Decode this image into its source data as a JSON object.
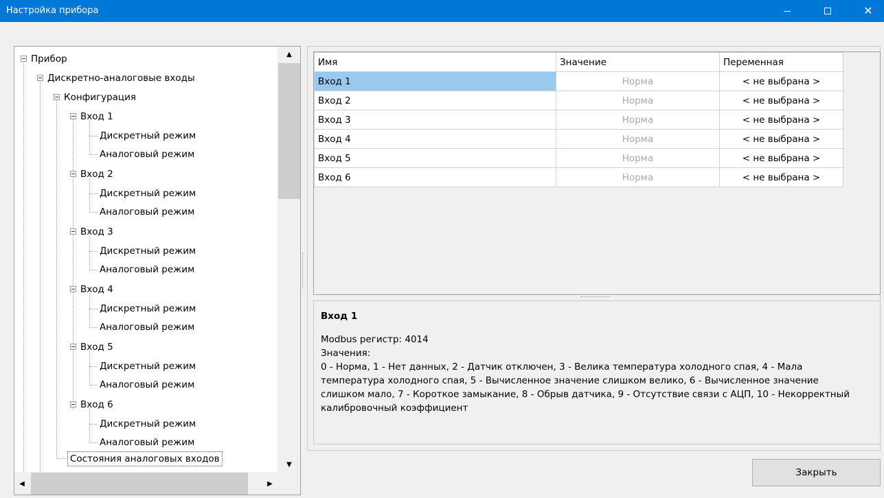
{
  "window": {
    "title": "Настройка прибора",
    "minimize_glyph": "—",
    "close_glyph": "✕"
  },
  "tree": {
    "root": "Прибор",
    "group": "Дискретно-аналоговые входы",
    "config": "Конфигурация",
    "inputs": [
      {
        "label": "Вход 1",
        "children": [
          "Дискретный режим",
          "Аналоговый режим"
        ]
      },
      {
        "label": "Вход 2",
        "children": [
          "Дискретный режим",
          "Аналоговый режим"
        ]
      },
      {
        "label": "Вход 3",
        "children": [
          "Дискретный режим",
          "Аналоговый режим"
        ]
      },
      {
        "label": "Вход 4",
        "children": [
          "Дискретный режим",
          "Аналоговый режим"
        ]
      },
      {
        "label": "Вход 5",
        "children": [
          "Дискретный режим",
          "Аналоговый режим"
        ]
      },
      {
        "label": "Вход 6",
        "children": [
          "Дискретный режим",
          "Аналоговый режим"
        ]
      }
    ],
    "selected": "Состояния аналоговых входов"
  },
  "grid": {
    "headers": [
      "Имя",
      "Значение",
      "Переменная"
    ],
    "rows": [
      {
        "name": "Вход 1",
        "value": "Норма",
        "variable": "< не выбрана >"
      },
      {
        "name": "Вход 2",
        "value": "Норма",
        "variable": "< не выбрана >"
      },
      {
        "name": "Вход 3",
        "value": "Норма",
        "variable": "< не выбрана >"
      },
      {
        "name": "Вход 4",
        "value": "Норма",
        "variable": "< не выбрана >"
      },
      {
        "name": "Вход 5",
        "value": "Норма",
        "variable": "< не выбрана >"
      },
      {
        "name": "Вход 6",
        "value": "Норма",
        "variable": "< не выбрана >"
      }
    ]
  },
  "description": {
    "title": "Вход 1",
    "register": "Modbus регистр: 4014",
    "values_label": "Значения:",
    "values_text": "0 - Норма, 1 - Нет данных, 2 - Датчик отключен, 3 - Велика температура холодного спая, 4 - Мала температура холодного спая, 5 - Вычисленное значение слишком велико, 6 - Вычисленное значение слишком мало, 7 - Короткое замыкание, 8 - Обрыв датчика, 9 - Отсутствие связи с АЦП, 10 - Некорректный калибровочный коэффициент"
  },
  "buttons": {
    "close": "Закрыть"
  },
  "colors": {
    "titlebar": "#0078d7",
    "selection": "#99c9ef",
    "value_text": "#a8a8a8"
  }
}
